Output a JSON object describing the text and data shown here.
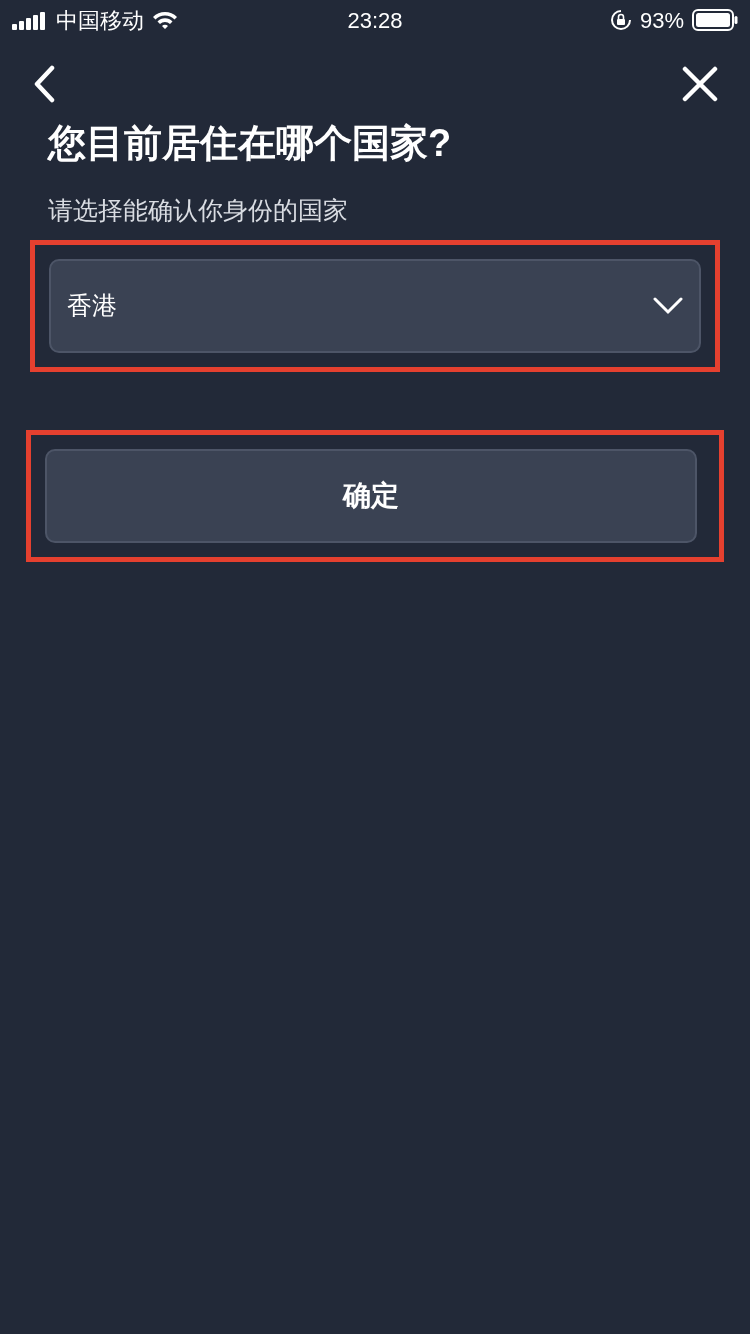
{
  "status_bar": {
    "carrier": "中国移动",
    "time": "23:28",
    "battery": "93%"
  },
  "title": "您目前居住在哪个国家?",
  "field_label": "请选择能确认你身份的国家",
  "country_select": {
    "value": "香港",
    "highlighted": true
  },
  "confirm_button": {
    "label": "确定",
    "highlighted": true
  }
}
